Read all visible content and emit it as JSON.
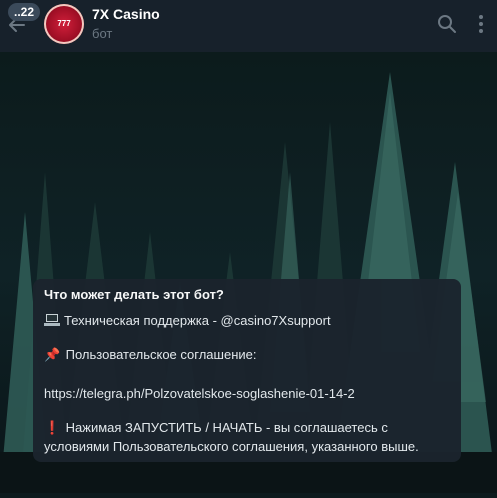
{
  "header": {
    "unread_count": "..22",
    "title": "7X Casino",
    "subtitle": "бот",
    "avatar_text": "777"
  },
  "card": {
    "title": "Что может делать этот бот?",
    "support_text": "Техническая поддержка - @casino7Xsupport",
    "agreement_emoji": "📌",
    "agreement_text": "Пользовательское соглашение:",
    "link": "https://telegra.ph/Polzovatelskoe-soglashenie-01-14-2",
    "warning_emoji": "❗",
    "warning_line1": "Нажимая ЗАПУСТИТЬ / НАЧАТЬ - вы соглашаетесь с",
    "warning_line2": "условиями Пользовательского соглашения, указанного выше."
  },
  "colors": {
    "header_bg": "#17212b",
    "card_bg": "#1b242d",
    "accent_red": "#c8172f"
  }
}
